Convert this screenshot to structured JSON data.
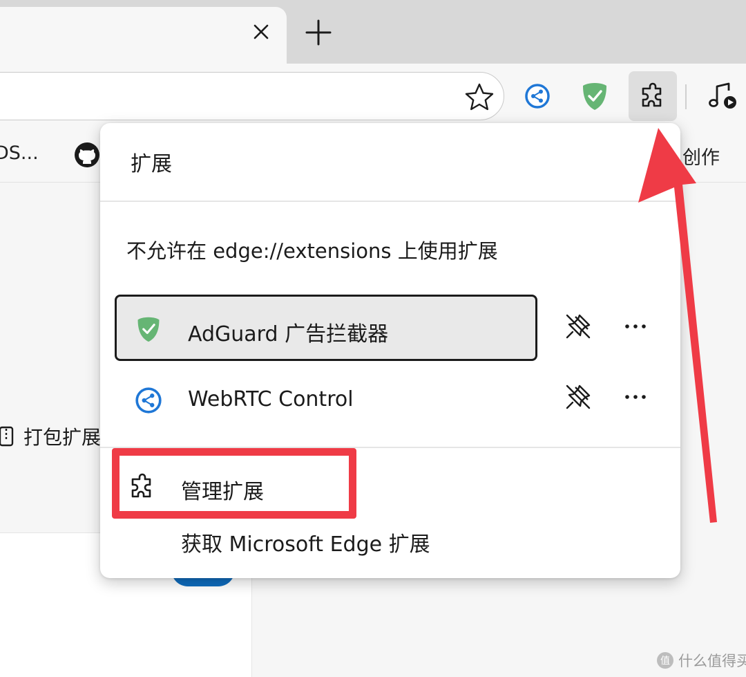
{
  "tab": {
    "close_icon": "close-icon",
    "new_tab_icon": "plus-icon"
  },
  "toolbar": {
    "favorite_icon": "star-icon",
    "extensions": [
      {
        "name": "webrtc-control-icon"
      },
      {
        "name": "adguard-icon"
      }
    ],
    "extensions_button_icon": "puzzle-icon",
    "media_icon": "music-play-icon"
  },
  "favorites_bar": {
    "left_item": "DS...",
    "right_item": "创作"
  },
  "page": {
    "pack_extension_label": "打包扩展"
  },
  "popup": {
    "title": "扩展",
    "restriction_note": "不允许在 edge://extensions 上使用扩展",
    "extensions": [
      {
        "name": "AdGuard 广告拦截器",
        "icon": "adguard-shield-icon",
        "selected": true
      },
      {
        "name": "WebRTC Control",
        "icon": "webrtc-share-icon",
        "selected": false
      }
    ],
    "pin_icon": "unpin-icon",
    "more_icon": "more-icon",
    "manage_label": "管理扩展",
    "get_label": "获取 Microsoft Edge 扩展"
  },
  "colors": {
    "annotation_red": "#ef3b46",
    "adguard_green": "#66b574",
    "webrtc_blue": "#1f77d6",
    "edge_blue": "#0f6cbd"
  },
  "watermark": {
    "text": "什么值得买"
  }
}
